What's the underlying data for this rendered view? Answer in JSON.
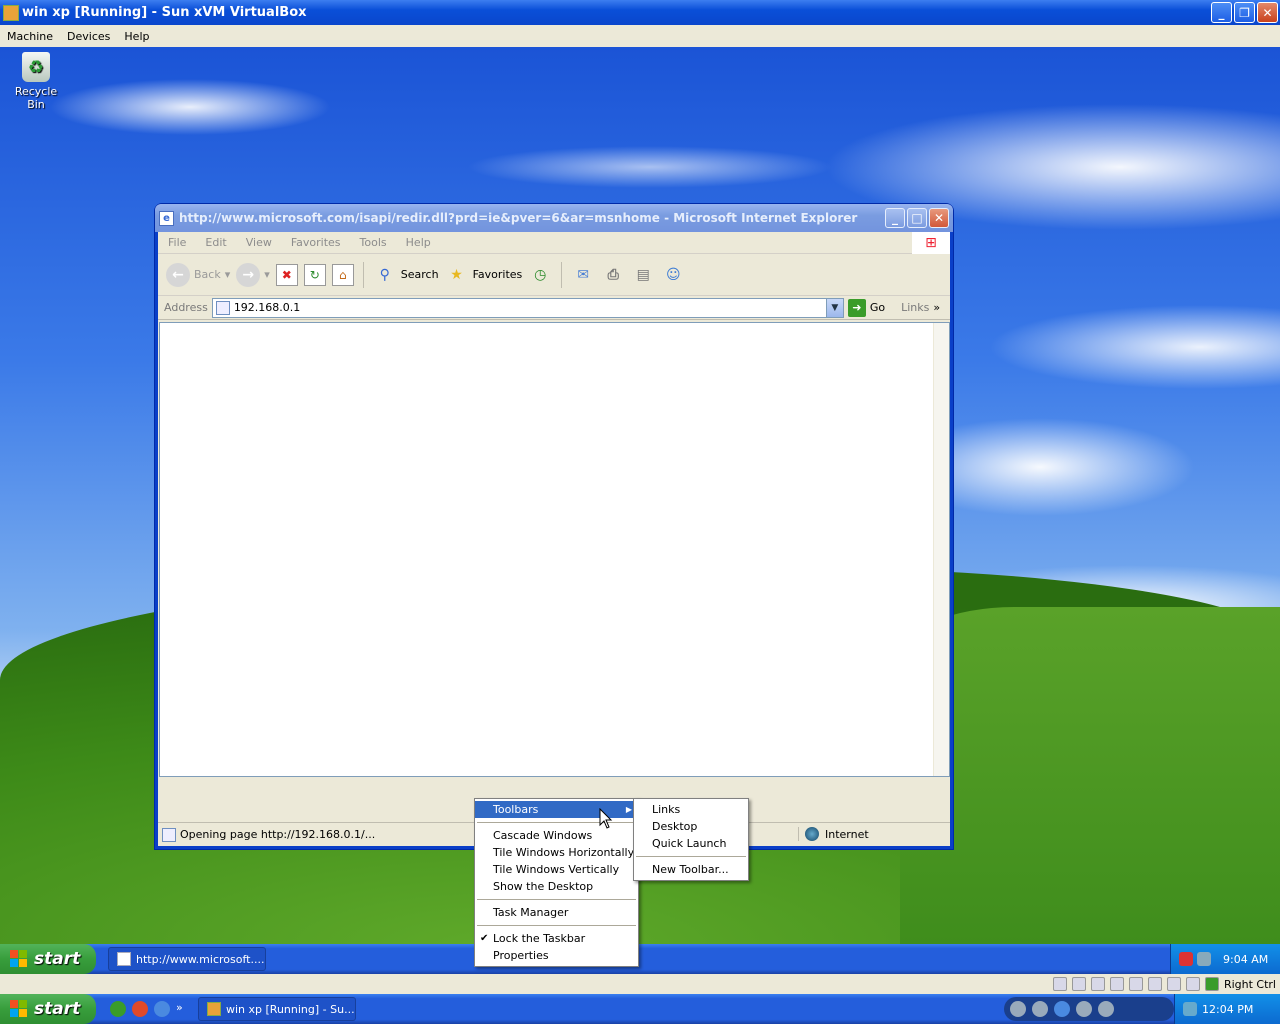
{
  "host": {
    "title": "win xp [Running] - Sun xVM VirtualBox",
    "menu": [
      "Machine",
      "Devices",
      "Help"
    ],
    "status_right": "Right Ctrl"
  },
  "desktop": {
    "icons": [
      {
        "label": "Recycle Bin",
        "icon": "recycle-bin-icon"
      }
    ]
  },
  "ie": {
    "title": "http://www.microsoft.com/isapi/redir.dll?prd=ie&pver=6&ar=msnhome - Microsoft Internet Explorer",
    "menu": [
      "File",
      "Edit",
      "View",
      "Favorites",
      "Tools",
      "Help"
    ],
    "toolbar": {
      "back": "Back",
      "search": "Search",
      "favorites": "Favorites"
    },
    "address_label": "Address",
    "address_value": "192.168.0.1",
    "go": "Go",
    "links": "Links",
    "status_text": "Opening page http://192.168.0.1/...",
    "zone": "Internet"
  },
  "guest_taskbar": {
    "start": "start",
    "task": "http://www.microsoft....",
    "clock": "9:04 AM"
  },
  "host_taskbar": {
    "start": "start",
    "quicklaunch_more": "»",
    "task": "win xp [Running] - Su...",
    "clock": "12:04 PM"
  },
  "context_menu": {
    "items": [
      {
        "label": "Toolbars",
        "submenu": true,
        "highlighted": true
      },
      {
        "label": "Cascade Windows"
      },
      {
        "label": "Tile Windows Horizontally"
      },
      {
        "label": "Tile Windows Vertically"
      },
      {
        "label": "Show the Desktop"
      },
      {
        "label": "Task Manager"
      },
      {
        "label": "Lock the Taskbar",
        "checked": true
      },
      {
        "label": "Properties"
      }
    ],
    "submenu": [
      "Links",
      "Desktop",
      "Quick Launch",
      "New Toolbar..."
    ]
  },
  "colors": {
    "xp_blue": "#245edc",
    "start_green": "#389e3c",
    "highlight": "#316ac5"
  }
}
